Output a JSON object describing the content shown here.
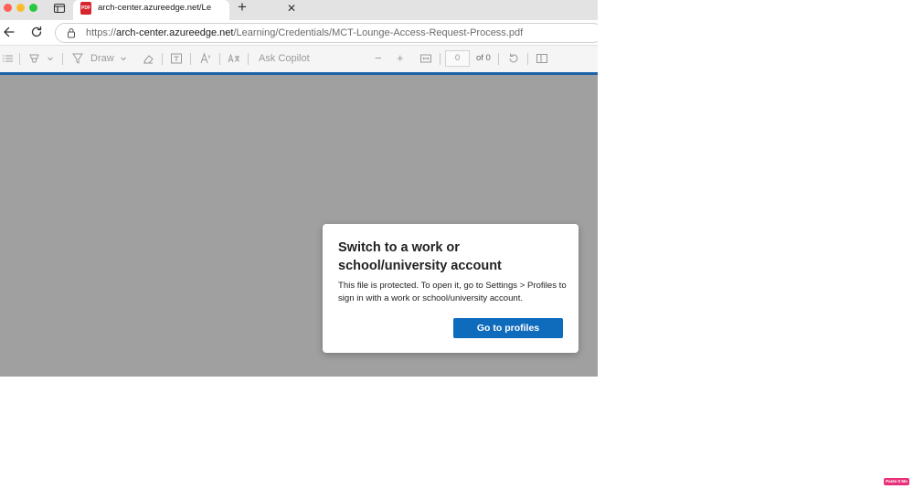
{
  "window": {
    "controls": [
      "close",
      "minimize",
      "zoom"
    ]
  },
  "tab": {
    "title": "arch-center.azureedge.net/Learning/Credentials/MCT-Lounge-Access-Request-Process.pdf",
    "favicon_text": "PDF",
    "favicon_icon": "pdf-icon"
  },
  "address_bar": {
    "scheme": "https://",
    "host": "arch-center.azureedge.net",
    "path": "/Learning/Credentials/MCT-Lounge-Access-Request-Process.pdf"
  },
  "pdf_toolbar": {
    "draw_label": "Draw",
    "copilot_label": "Ask Copilot",
    "page_value": "0",
    "page_total": "of 0",
    "accent_color": "#1a63a6"
  },
  "dialog": {
    "title": "Switch to a work or school/university account",
    "body": "This file is protected. To open it, go to Settings > Profiles to sign in with a work or school/university account.",
    "button_label": "Go to profiles",
    "button_color": "#0f6cbd"
  },
  "badge": {
    "label": "Paste It Mo"
  }
}
